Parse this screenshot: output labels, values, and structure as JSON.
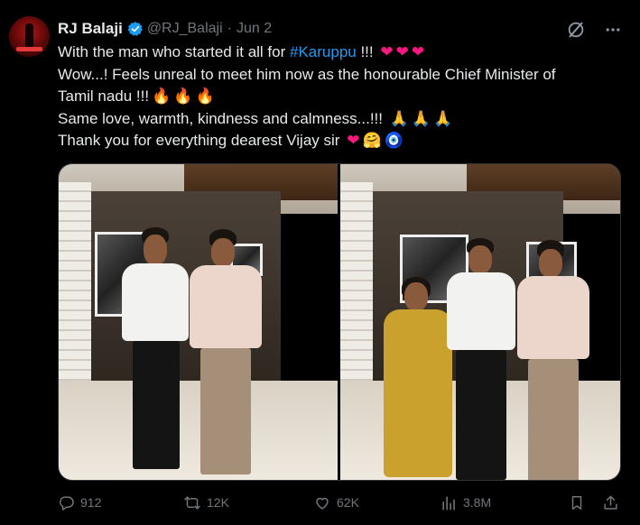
{
  "tweet": {
    "author_name": "RJ Balaji",
    "handle": "@RJ_Balaji",
    "separator": "·",
    "date": "Jun 2",
    "lines": {
      "l1_text": "With the man who started it all for ",
      "l1_hashtag": "#Karuppu",
      "l1_tail": " !!!",
      "l2_text": "Wow...! Feels unreal to meet him now as the honourable Chief Minister of",
      "l3_text": "Tamil nadu !!!",
      "l4_text": "Same love, warmth, kindness and calmness...!!!",
      "l5_text": "Thank you for everything dearest Vijay sir"
    },
    "emoji": {
      "heart": "❤",
      "fire": "🔥",
      "pray": "🙏",
      "hug": "🤗",
      "nazar": "🧿"
    }
  },
  "actions": {
    "replies": "912",
    "reposts": "12K",
    "likes": "62K",
    "views": "3.8M"
  },
  "icons": [
    "verified-badge-icon",
    "grok-icon",
    "more-icon",
    "reply-icon",
    "repost-icon",
    "like-icon",
    "views-icon",
    "bookmark-icon",
    "share-icon"
  ],
  "colors": {
    "background": "#000000",
    "text": "#e7e9ea",
    "muted": "#71767b",
    "link": "#1d9bf0",
    "verified": "#1d9bf0",
    "heart": "#f91880"
  }
}
